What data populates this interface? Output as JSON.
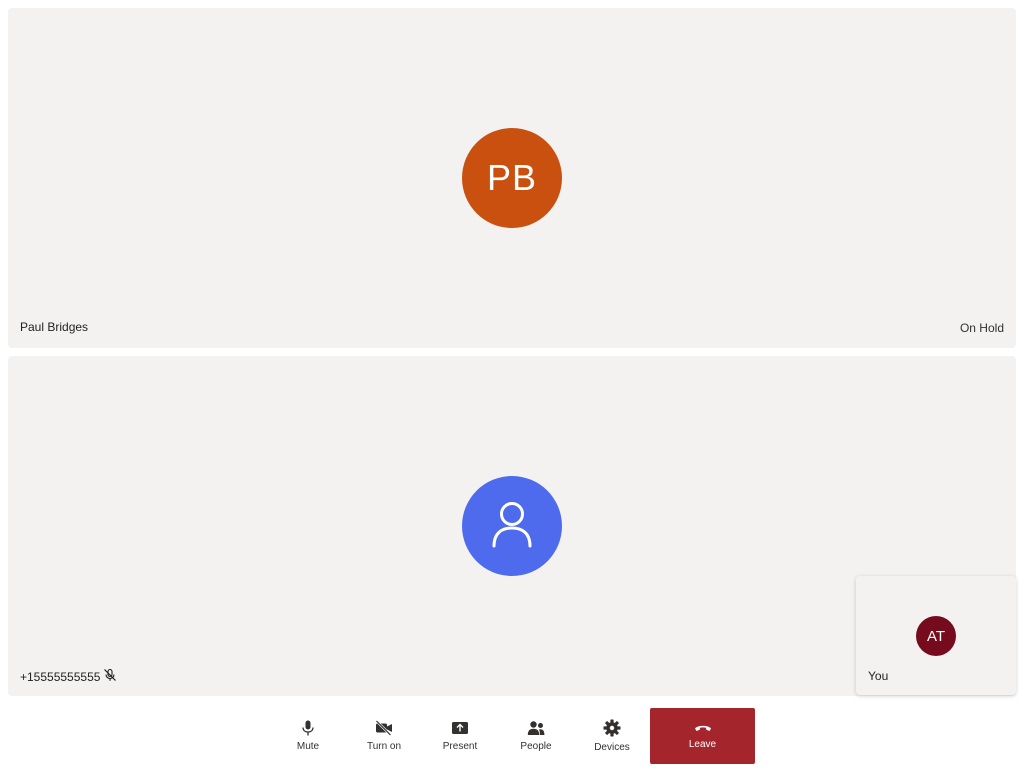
{
  "participants": [
    {
      "name": "Paul Bridges",
      "initials": "PB",
      "status": "On Hold",
      "avatar_color": "#ca5010"
    },
    {
      "name": "+15555555555",
      "avatar_icon": "person-icon",
      "muted_icon": "mic-off-icon",
      "avatar_color": "#4f6bed"
    }
  ],
  "self_view": {
    "initials": "AT",
    "label": "You",
    "avatar_color": "#750b1c"
  },
  "controls": {
    "mute": {
      "label": "Mute",
      "icon": "microphone-icon"
    },
    "camera": {
      "label": "Turn on",
      "icon": "camera-off-icon"
    },
    "present": {
      "label": "Present",
      "icon": "share-screen-icon"
    },
    "people": {
      "label": "People",
      "icon": "people-icon"
    },
    "devices": {
      "label": "Devices",
      "icon": "gear-icon"
    },
    "leave": {
      "label": "Leave",
      "icon": "hang-up-icon",
      "color": "#a4262c"
    }
  }
}
